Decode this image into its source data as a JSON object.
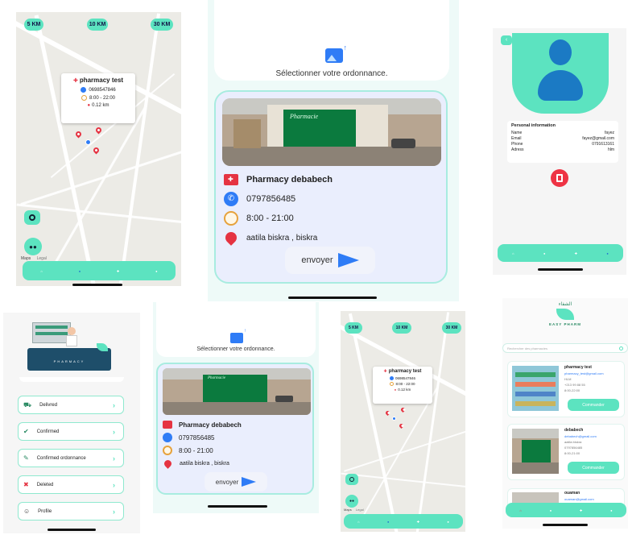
{
  "map": {
    "chips": [
      "5 KM",
      "10 KM",
      "30 KM"
    ],
    "popup1": {
      "name": "pharmacy test",
      "phone": "0698547846",
      "hours": "8:00 - 22:00",
      "distance": "0.12 km"
    },
    "popup2": {
      "name": "pharmacy test",
      "phone": "0698547846",
      "hours": "8:00 - 22:00",
      "distance": "0.12 km"
    },
    "attribution": "Maps",
    "legal": "Legal"
  },
  "upload": {
    "select_label": "Sélectionner votre ordonnance.",
    "pharmacy_name": "Pharmacy debabech",
    "phone": "0797856485",
    "hours": "8:00 - 21:00",
    "address": "aatila biskra , biskra",
    "send_label": "envoyer",
    "sign_text": "Pharmacie"
  },
  "profile": {
    "section_title": "Personal information",
    "rows": [
      {
        "label": "Name",
        "value": "fayez"
      },
      {
        "label": "Email",
        "value": "fayez@gmail.com"
      },
      {
        "label": "Phone",
        "value": "0791613161"
      },
      {
        "label": "Adress",
        "value": "hlm"
      }
    ]
  },
  "menu": {
    "banner_text": "PHARMACY",
    "items": [
      {
        "label": "Delivred"
      },
      {
        "label": "Confirmed"
      },
      {
        "label": "Confirmed ordonnance"
      },
      {
        "label": "Deleted"
      },
      {
        "label": "Profile"
      }
    ]
  },
  "list": {
    "brand_arabic": "الشفاء",
    "brand": "EASY PHARM",
    "search_placeholder": "Rechercher des pharmacies",
    "items": [
      {
        "name": "pharmacy test",
        "email": "pharmacy_test@gmail.com",
        "address": "HLM",
        "phone": "+213 99 88 55",
        "hours": "8:00-22:00",
        "button": "Commander"
      },
      {
        "name": "debabech",
        "email": "debabech@gmail.com",
        "address": "aatila biskra",
        "phone": "0797856485",
        "hours": "8:00-21:00",
        "button": "Commander"
      },
      {
        "name": "ouaman",
        "email": "ouaman@gmail.com"
      }
    ]
  },
  "colors": {
    "accent": "#5ce3c0",
    "pin": "#e53342",
    "danger": "#ee3344"
  }
}
